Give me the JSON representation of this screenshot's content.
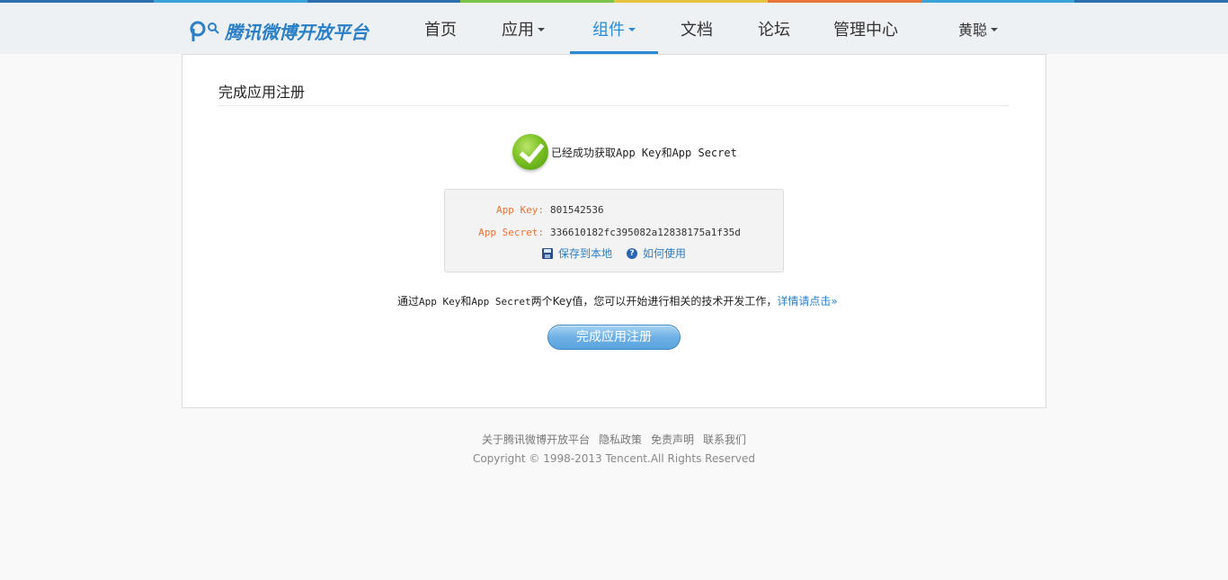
{
  "strip_colors": [
    "#2e6fb0",
    "#3aa3d8",
    "#2e6fb0",
    "#7dc24b",
    "#e7c23c",
    "#e8753a",
    "#3aa3d8",
    "#2e6fb0"
  ],
  "brand": {
    "title": "腾讯微博开放平台",
    "logo_icon": "weibo-logo-icon"
  },
  "nav": {
    "items": [
      {
        "label": "首页",
        "dropdown": false,
        "active": false
      },
      {
        "label": "应用",
        "dropdown": true,
        "active": false
      },
      {
        "label": "组件",
        "dropdown": true,
        "active": true
      },
      {
        "label": "文档",
        "dropdown": false,
        "active": false
      },
      {
        "label": "论坛",
        "dropdown": false,
        "active": false
      },
      {
        "label": "管理中心",
        "dropdown": false,
        "active": false
      }
    ],
    "user": "黄聪"
  },
  "panel": {
    "title": "完成应用注册",
    "success_icon": "check-circle-icon",
    "success_text": "已经成功获取App Key和App Secret",
    "app_key_label": "App Key:",
    "app_key_value": "801542536",
    "app_secret_label": "App Secret:",
    "app_secret_value": "336610182fc395082a12838175a1f35d",
    "save_label": "保存到本地",
    "help_label": "如何使用",
    "info_prefix": "通过",
    "info_keys": "App Key",
    "info_and": "和",
    "info_secret": "App Secret",
    "info_suffix": "两个Key值，您可以开始进行相关的技术开发工作，",
    "info_link": "详情请点击»",
    "finish_button": "完成应用注册"
  },
  "footer": {
    "links": [
      "关于腾讯微博开放平台",
      "隐私政策",
      "免责声明",
      "联系我们"
    ],
    "copyright": "Copyright © 1998-2013 Tencent.All Rights Reserved"
  }
}
